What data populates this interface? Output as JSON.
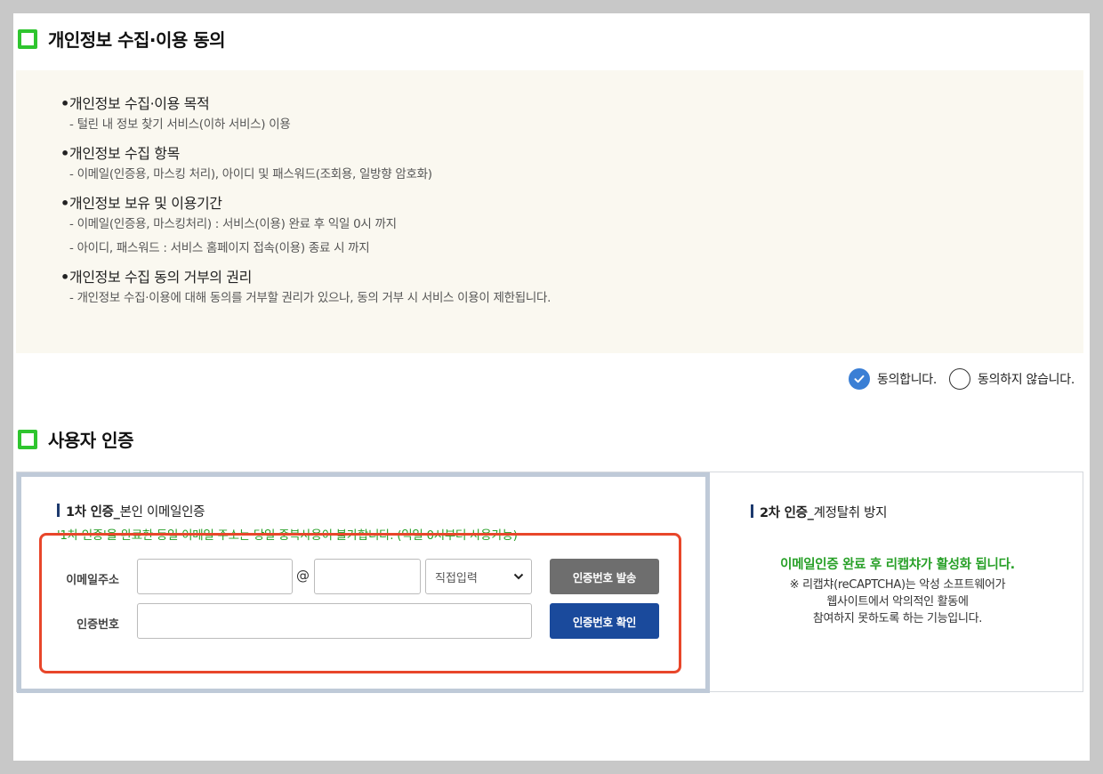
{
  "consent": {
    "title": "개인정보 수집·이용 동의",
    "terms": [
      {
        "head": "개인정보 수집·이용 목적",
        "lines": [
          "- 털린 내 정보 찾기 서비스(이하 서비스) 이용"
        ]
      },
      {
        "head": "개인정보 수집 항목",
        "lines": [
          "- 이메일(인증용, 마스킹 처리), 아이디 및 패스워드(조회용, 일방향 암호화)"
        ]
      },
      {
        "head": "개인정보 보유 및 이용기간",
        "lines": [
          "- 이메일(인증용, 마스킹처리) : 서비스(이용) 완료 후 익일 0시 까지",
          "- 아이디, 패스워드 : 서비스 홈페이지 접속(이용) 종료 시 까지"
        ]
      },
      {
        "head": "개인정보 수집 동의 거부의 권리",
        "lines": [
          "- 개인정보 수집·이용에 대해 동의를 거부할 권리가 있으나, 동의 거부 시 서비스 이용이 제한됩니다."
        ]
      }
    ],
    "agree_label": "동의합니다.",
    "disagree_label": "동의하지 않습니다.",
    "agree_selected": true
  },
  "auth": {
    "title": "사용자 인증",
    "first": {
      "label_bold": "1차 인증_",
      "label_rest": "본인 이메일인증",
      "notice": "'1차 인증'을 완료한 동일 이메일 주소는 당일 중복사용이 불가합니다. (익일 0시부터 사용가능)",
      "email_label": "이메일주소",
      "email_local": "",
      "at": "@",
      "email_domain": "",
      "domain_select": "직접입력",
      "send_button": "인증번호 발송",
      "code_label": "인증번호",
      "code_value": "",
      "confirm_button": "인증번호 확인"
    },
    "second": {
      "label_bold": "2차 인증_",
      "label_rest": "계정탈취 방지",
      "message": "이메일인증 완료 후 리캡챠가 활성화 됩니다.",
      "desc_lines": [
        "※ 리캡챠(reCAPTCHA)는 악성 소프트웨어가",
        "웹사이트에서 악의적인 활동에",
        "참여하지 못하도록 하는 기능입니다."
      ]
    }
  },
  "colors": {
    "accent_green": "#2fc52f",
    "notice_green": "#28a028",
    "primary_blue": "#1a4a9c",
    "highlight_red": "#e8462a"
  }
}
